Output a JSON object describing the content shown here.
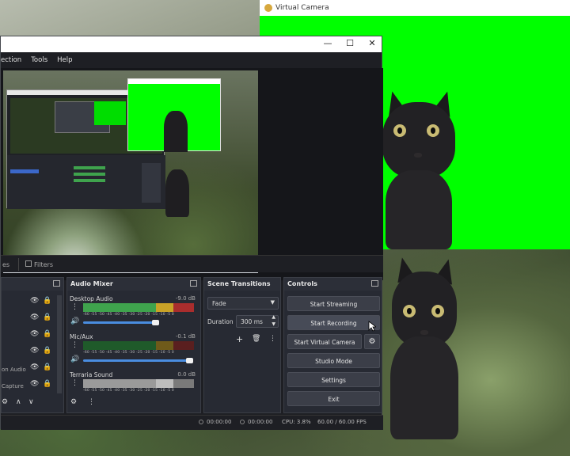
{
  "virtual_camera": {
    "title": "Virtual Camera"
  },
  "obs": {
    "menu": [
      "ection",
      "Tools",
      "Help"
    ],
    "window_buttons": {
      "minimize": "—",
      "maximize": "☐",
      "close": "✕"
    },
    "tabs": {
      "sources_partial": "es",
      "filters": "Filters"
    },
    "sources": {
      "items": [
        {
          "label": ""
        },
        {
          "label": ""
        },
        {
          "label": ""
        },
        {
          "label": ""
        },
        {
          "label": "on Audio"
        },
        {
          "label": "Capture"
        }
      ]
    },
    "audio_mixer": {
      "title": "Audio Mixer",
      "tracks": [
        {
          "name": "Desktop Audio",
          "db": "-9.0 dB",
          "level": 0.93
        },
        {
          "name": "Mic/Aux",
          "db": "-0.1 dB",
          "level": 1.0
        },
        {
          "name": "Terraria Sound",
          "db": "0.0 dB",
          "level": 1.0
        }
      ],
      "scale": "-60 -55 -50 -45 -40 -35 -30 -25 -20 -15 -10 -5 0"
    },
    "scene_transitions": {
      "title": "Scene Transitions",
      "transition": "Fade",
      "duration_label": "Duration",
      "duration_value": "300 ms"
    },
    "controls": {
      "title": "Controls",
      "start_streaming": "Start Streaming",
      "start_recording": "Start Recording",
      "start_virtual_camera": "Start Virtual Camera",
      "studio_mode": "Studio Mode",
      "settings": "Settings",
      "exit": "Exit"
    },
    "status": {
      "stream_time": "00:00:00",
      "record_time": "00:00:00",
      "cpu": "CPU: 3.8%",
      "fps": "60.00 / 60.00 FPS"
    }
  },
  "colors": {
    "greenscreen": "#00ff00",
    "obs_bg": "#1e1f24",
    "dock_bg": "#272a33",
    "accent_blue": "#4a8de0"
  }
}
